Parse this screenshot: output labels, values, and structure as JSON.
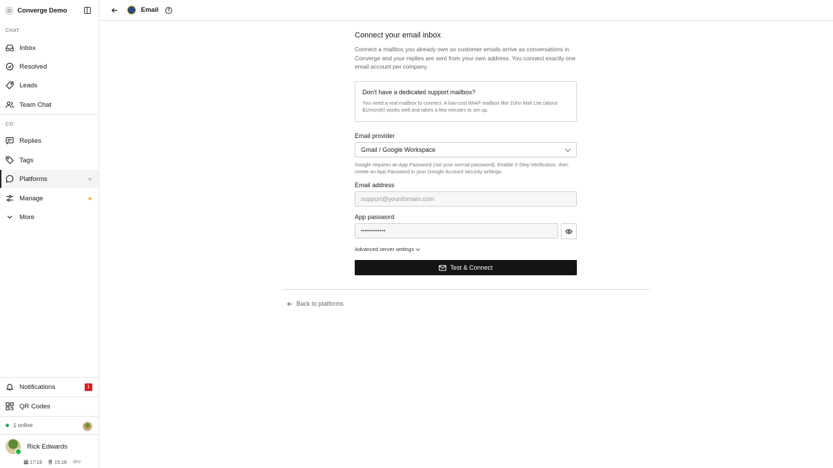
{
  "app": {
    "name": "Converge Demo"
  },
  "sidebar": {
    "chat_label": "CHAT",
    "chat_items": [
      {
        "label": "Inbox",
        "icon": "inbox-icon"
      },
      {
        "label": "Resolved",
        "icon": "check-circle-icon"
      },
      {
        "label": "Leads",
        "icon": "tag-icon"
      },
      {
        "label": "Team Chat",
        "icon": "users-icon"
      }
    ],
    "co_label": "CO",
    "co_items": [
      {
        "label": "Replies",
        "icon": "reply-icon"
      },
      {
        "label": "Tags",
        "icon": "tag-icon"
      },
      {
        "label": "Platforms",
        "icon": "message-circle-icon",
        "active": true,
        "star": "★"
      },
      {
        "label": "Manage",
        "icon": "sliders-icon",
        "star": "★"
      },
      {
        "label": "More",
        "icon": "chevron-down-icon"
      }
    ],
    "notifications": {
      "label": "Notifications",
      "badge": "1"
    },
    "qr_codes": {
      "label": "QR Codes"
    },
    "online": "1 online",
    "user": {
      "name": "Rick Edwards"
    },
    "meta": {
      "time1": "17:18",
      "time2": "15:18",
      "env": "dev"
    }
  },
  "topbar": {
    "title": "Email"
  },
  "form": {
    "heading": "Connect your email inbox",
    "description": "Connect a mailbox you already own so customer emails arrive as conversations in Converge and your replies are sent from your own address. You connect exactly one email account per company.",
    "info_title": "Don't have a dedicated support mailbox?",
    "info_body": "You need a real mailbox to connect. A low-cost IMAP mailbox like Zoho Mail Lite (about $1/month) works well and takes a few minutes to set up.",
    "provider_label": "Email provider",
    "provider_value": "Gmail / Google Workspace",
    "provider_hint": "Google requires an App Password (not your normal password). Enable 2-Step Verification, then create an App Password in your Google Account security settings.",
    "email_label": "Email address",
    "email_placeholder": "support@yourdomain.com",
    "password_label": "App password",
    "password_value": "••••••••••••",
    "advanced_label": "Advanced server settings",
    "submit_label": "Test & Connect",
    "back_label": "Back to platforms"
  },
  "colors": {
    "accent": "#141414",
    "online": "#22b14c",
    "badge": "#d62020",
    "star": "#f0a020"
  }
}
